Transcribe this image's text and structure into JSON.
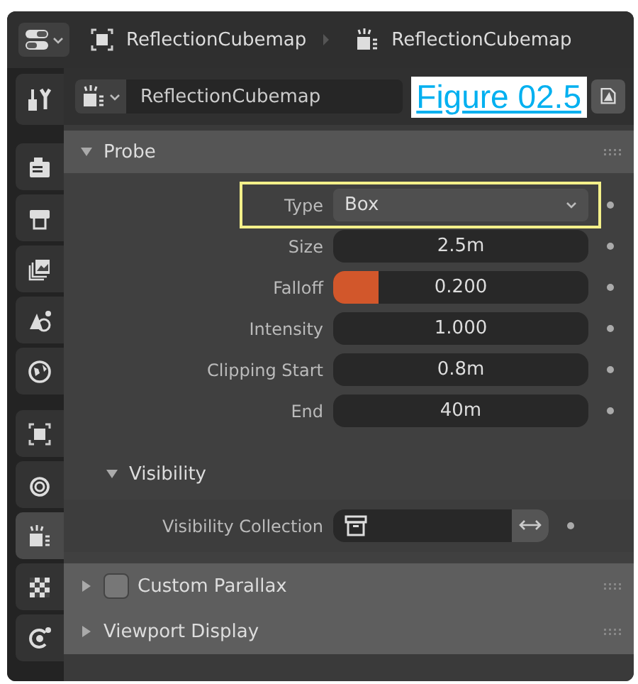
{
  "breadcrumb": {
    "object_name": "ReflectionCubemap",
    "data_name": "ReflectionCubemap"
  },
  "tabs": [
    {
      "kind": "tool",
      "selected": false
    },
    {
      "kind": "render",
      "selected": false
    },
    {
      "kind": "output",
      "selected": false
    },
    {
      "kind": "view-layer",
      "selected": false
    },
    {
      "kind": "scene",
      "selected": false
    },
    {
      "kind": "world",
      "selected": false
    },
    {
      "kind": "object",
      "selected": false
    },
    {
      "kind": "physics",
      "selected": false
    },
    {
      "kind": "probe",
      "selected": true
    },
    {
      "kind": "texture",
      "selected": false
    },
    {
      "kind": "constraint",
      "selected": false
    }
  ],
  "datablock": {
    "name": "ReflectionCubemap"
  },
  "figure_label": "Figure 02.5",
  "panels": [
    {
      "title": "Probe",
      "expanded": true,
      "fields": [
        {
          "label": "Type",
          "kind": "dropdown",
          "value": "Box",
          "highlighted": true
        },
        {
          "label": "Size",
          "kind": "number",
          "value": "2.5m",
          "highlighted": false
        },
        {
          "label": "Falloff",
          "kind": "slider",
          "value": "0.200",
          "level": 0.18,
          "highlighted": false
        },
        {
          "label": "Intensity",
          "kind": "number",
          "value": "1.000",
          "highlighted": false
        },
        {
          "label": "Clipping Start",
          "kind": "number",
          "value": "0.8m",
          "highlighted": false
        },
        {
          "label": "End",
          "kind": "number",
          "value": "40m",
          "highlighted": false
        }
      ],
      "subpanels": [
        {
          "title": "Visibility",
          "expanded": true,
          "fields": [
            {
              "label": "Visibility Collection",
              "kind": "collection",
              "highlighted": false
            }
          ]
        }
      ]
    },
    {
      "title": "Custom Parallax",
      "expanded": false,
      "checkbox": {
        "checked": false
      }
    },
    {
      "title": "Viewport Display",
      "expanded": false
    }
  ]
}
